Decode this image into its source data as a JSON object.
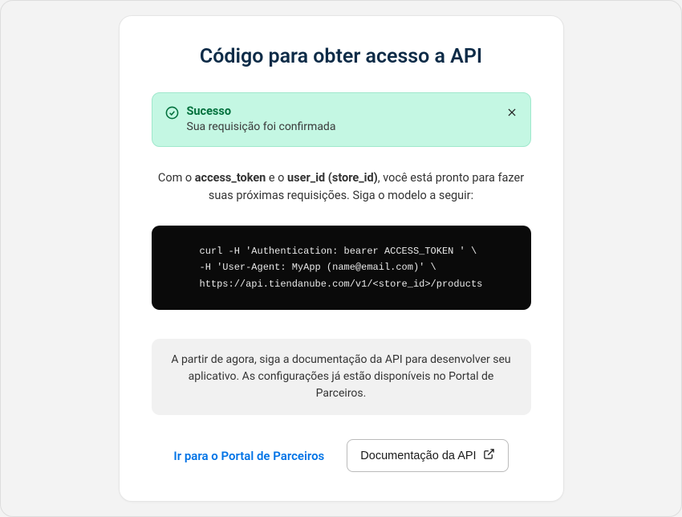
{
  "title": "Código para obter acesso a API",
  "alert": {
    "title": "Sucesso",
    "message": "Sua requisição foi confirmada"
  },
  "description": {
    "prefix": "Com o ",
    "bold1": "access_token",
    "mid": " e o ",
    "bold2": "user_id (store_id)",
    "suffix": ", você está pronto para fazer suas próximas requisições. Siga o modelo a seguir:"
  },
  "code": "curl -H 'Authentication: bearer ACCESS_TOKEN ' \\  -H 'User-Agent: MyApp (name@email.com)' \\  https://api.tiendanube.com/v1/<store_id>/products",
  "info": "A partir de agora, siga a documentação da API para desenvolver seu aplicativo. As configurações já estão disponíveis no Portal de Parceiros.",
  "actions": {
    "portal_link": "Ir para o Portal de Parceiros",
    "docs_button": "Documentação da API"
  }
}
